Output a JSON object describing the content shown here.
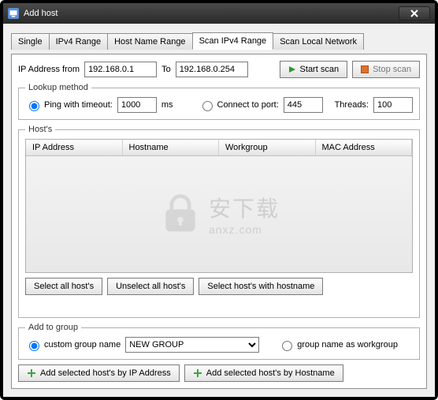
{
  "window": {
    "title": "Add host"
  },
  "tabs": [
    "Single",
    "IPv4 Range",
    "Host Name Range",
    "Scan IPv4 Range",
    "Scan Local Network"
  ],
  "activeTab": 3,
  "ipRange": {
    "fromLabel": "IP Address from",
    "fromValue": "192.168.0.1",
    "toLabel": "To",
    "toValue": "192.168.0.254"
  },
  "buttons": {
    "startScan": "Start scan",
    "stopScan": "Stop scan",
    "selectAll": "Select all host's",
    "unselectAll": "Unselect all host's",
    "selectWithHostname": "Select host's with hostname",
    "addByIp": "Add selected host's by IP Address",
    "addByHostname": "Add selected host's by Hostname"
  },
  "lookup": {
    "legend": "Lookup method",
    "pingLabel": "Ping with timeout:",
    "pingValue": "1000",
    "pingUnit": "ms",
    "connectLabel": "Connect to port:",
    "connectValue": "445",
    "threadsLabel": "Threads:",
    "threadsValue": "100",
    "pingSelected": true
  },
  "hosts": {
    "legend": "Host's",
    "columns": [
      "IP Address",
      "Hostname",
      "Workgroup",
      "MAC Address"
    ],
    "rows": []
  },
  "addGroup": {
    "legend": "Add to group",
    "customLabel": "custom group name",
    "customValue": "NEW GROUP",
    "workgroupLabel": "group name as workgroup",
    "customSelected": true
  },
  "watermark": {
    "cn": "安下载",
    "domain": "anxz.com"
  }
}
